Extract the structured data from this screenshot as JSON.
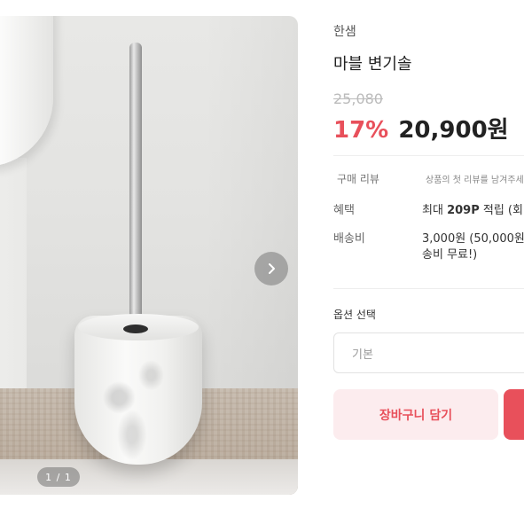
{
  "gallery": {
    "counter": "1 / 1",
    "next_icon": "chevron-right-icon"
  },
  "product": {
    "brand": "한샘",
    "title": "마블 변기솔",
    "original_price": "25,080",
    "discount": "17%",
    "sale_price": "20,900원"
  },
  "info_rows": {
    "review": {
      "label": "구매 리뷰",
      "value": "상품의 첫 리뷰를 남겨주세요"
    },
    "benefit": {
      "label": "혜택",
      "value_prefix": "최대 ",
      "value_bold": "209P",
      "value_suffix": " 적립 (회"
    },
    "shipping": {
      "label": "배송비",
      "value_line1": "3,000원 (50,000원",
      "value_line2": "송비 무료!)"
    }
  },
  "options": {
    "heading": "옵션 선택",
    "selected": "기본"
  },
  "actions": {
    "cart_label": "장바구니 담기"
  },
  "colors": {
    "accent": "#e8505b",
    "cart_bg": "#fcecee"
  }
}
